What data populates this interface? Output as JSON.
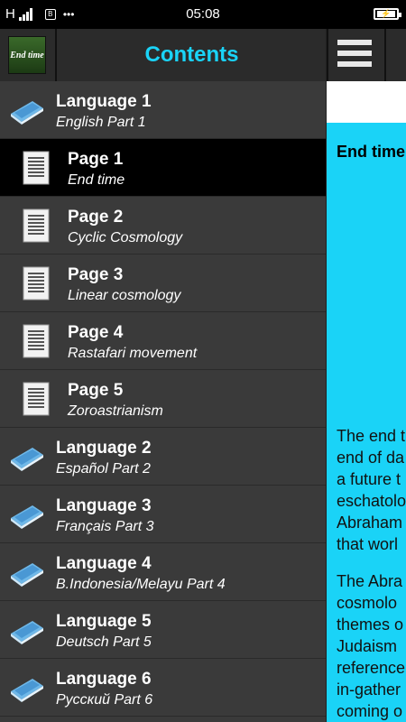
{
  "status_bar": {
    "network": "H",
    "time": "05:08",
    "notification": "B",
    "dots": "•••",
    "battery_icon": "battery-charging-icon"
  },
  "drawer": {
    "title": "Contents",
    "logo_text": "End time",
    "items": [
      {
        "type": "language",
        "title": "Language 1",
        "subtitle": "English Part 1",
        "icon": "book-icon"
      },
      {
        "type": "page",
        "title": "Page 1",
        "subtitle": "End time",
        "icon": "document-icon",
        "selected": true
      },
      {
        "type": "page",
        "title": "Page 2",
        "subtitle": "Cyclic Cosmology",
        "icon": "document-icon"
      },
      {
        "type": "page",
        "title": "Page 3",
        "subtitle": "Linear cosmology",
        "icon": "document-icon"
      },
      {
        "type": "page",
        "title": "Page 4",
        "subtitle": "Rastafari movement",
        "icon": "document-icon"
      },
      {
        "type": "page",
        "title": "Page 5",
        "subtitle": "Zoroastrianism",
        "icon": "document-icon"
      },
      {
        "type": "language",
        "title": "Language 2",
        "subtitle": "Español Part 2",
        "icon": "book-icon"
      },
      {
        "type": "language",
        "title": "Language 3",
        "subtitle": "Français Part 3",
        "icon": "book-icon"
      },
      {
        "type": "language",
        "title": "Language 4",
        "subtitle": "B.Indonesia/Melayu Part 4",
        "icon": "book-icon"
      },
      {
        "type": "language",
        "title": "Language 5",
        "subtitle": "Deutsch Part 5",
        "icon": "book-icon"
      },
      {
        "type": "language",
        "title": "Language 6",
        "subtitle": "Русский Part 6",
        "icon": "book-icon"
      }
    ]
  },
  "content": {
    "menu_icon": "hamburger-menu-icon",
    "title": "End time",
    "paragraph1_lines": [
      "The end t",
      "end of da",
      "a future t",
      "eschatolo",
      "Abraham",
      "that worl"
    ],
    "paragraph2_lines": [
      "The Abra",
      "cosmolo",
      "themes o",
      "Judaism",
      "reference",
      "in-gather",
      "coming o"
    ]
  },
  "colors": {
    "accent": "#1ad3f7",
    "drawer_bg": "#3a3a3a",
    "header_bg": "#2b2b2b",
    "selected_bg": "#000000"
  }
}
